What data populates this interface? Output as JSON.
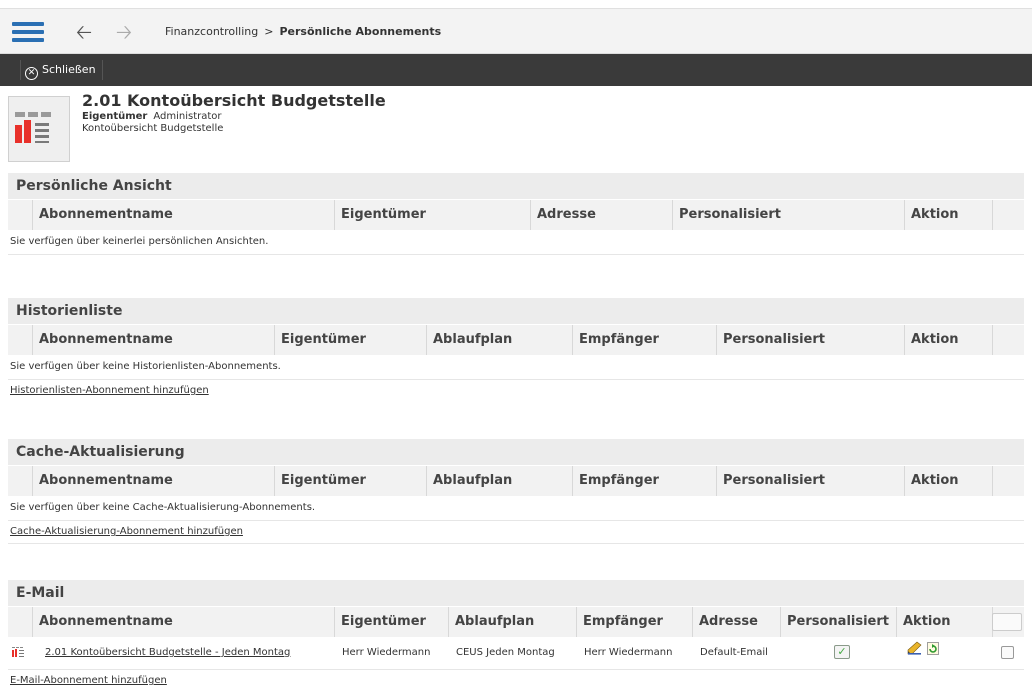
{
  "breadcrumb": {
    "parent": "Finanzcontrolling",
    "separator": ">",
    "current": "Persönliche Abonnements"
  },
  "toolbar": {
    "close_label": "Schließen"
  },
  "report": {
    "title": "2.01 Kontoübersicht Budgetstelle",
    "owner_label": "Eigentümer",
    "owner_value": "Administrator",
    "description": "Kontoübersicht Budgetstelle"
  },
  "personal": {
    "title": "Persönliche Ansicht",
    "columns": [
      "Abonnementname",
      "Eigentümer",
      "Adresse",
      "Personalisiert",
      "Aktion"
    ],
    "empty": "Sie verfügen über keinerlei persönlichen Ansichten."
  },
  "history": {
    "title": "Historienliste",
    "columns": [
      "Abonnementname",
      "Eigentümer",
      "Ablaufplan",
      "Empfänger",
      "Personalisiert",
      "Aktion"
    ],
    "empty": "Sie verfügen über keine Historienlisten-Abonnements.",
    "add": "Historienlisten-Abonnement hinzufügen"
  },
  "cache": {
    "title": "Cache-Aktualisierung",
    "columns": [
      "Abonnementname",
      "Eigentümer",
      "Ablaufplan",
      "Empfänger",
      "Personalisiert",
      "Aktion"
    ],
    "empty": "Sie verfügen über keine Cache-Aktualisierung-Abonnements.",
    "add": "Cache-Aktualisierung-Abonnement hinzufügen"
  },
  "email": {
    "title": "E-Mail",
    "columns": [
      "Abonnementname",
      "Eigentümer",
      "Ablaufplan",
      "Empfänger",
      "Adresse",
      "Personalisiert",
      "Aktion"
    ],
    "rows": [
      {
        "name": "2.01 Kontoübersicht Budgetstelle - Jeden Montag",
        "owner": "Herr Wiedermann",
        "schedule": "CEUS Jeden Montag",
        "recipient": "Herr Wiedermann",
        "address": "Default-Email",
        "personalized": true,
        "selected": false
      }
    ],
    "add": "E-Mail-Abonnement hinzufügen"
  },
  "icons": {
    "menu": "hamburger-icon",
    "back": "arrow-left-icon",
    "forward": "arrow-right-icon",
    "close": "close-circle-icon",
    "report": "report-icon",
    "edit": "edit-pencil-icon",
    "refresh": "refresh-icon"
  },
  "colors": {
    "accent": "#2a6fb3",
    "toolbar": "#3a3a3a",
    "section": "#ececec"
  }
}
